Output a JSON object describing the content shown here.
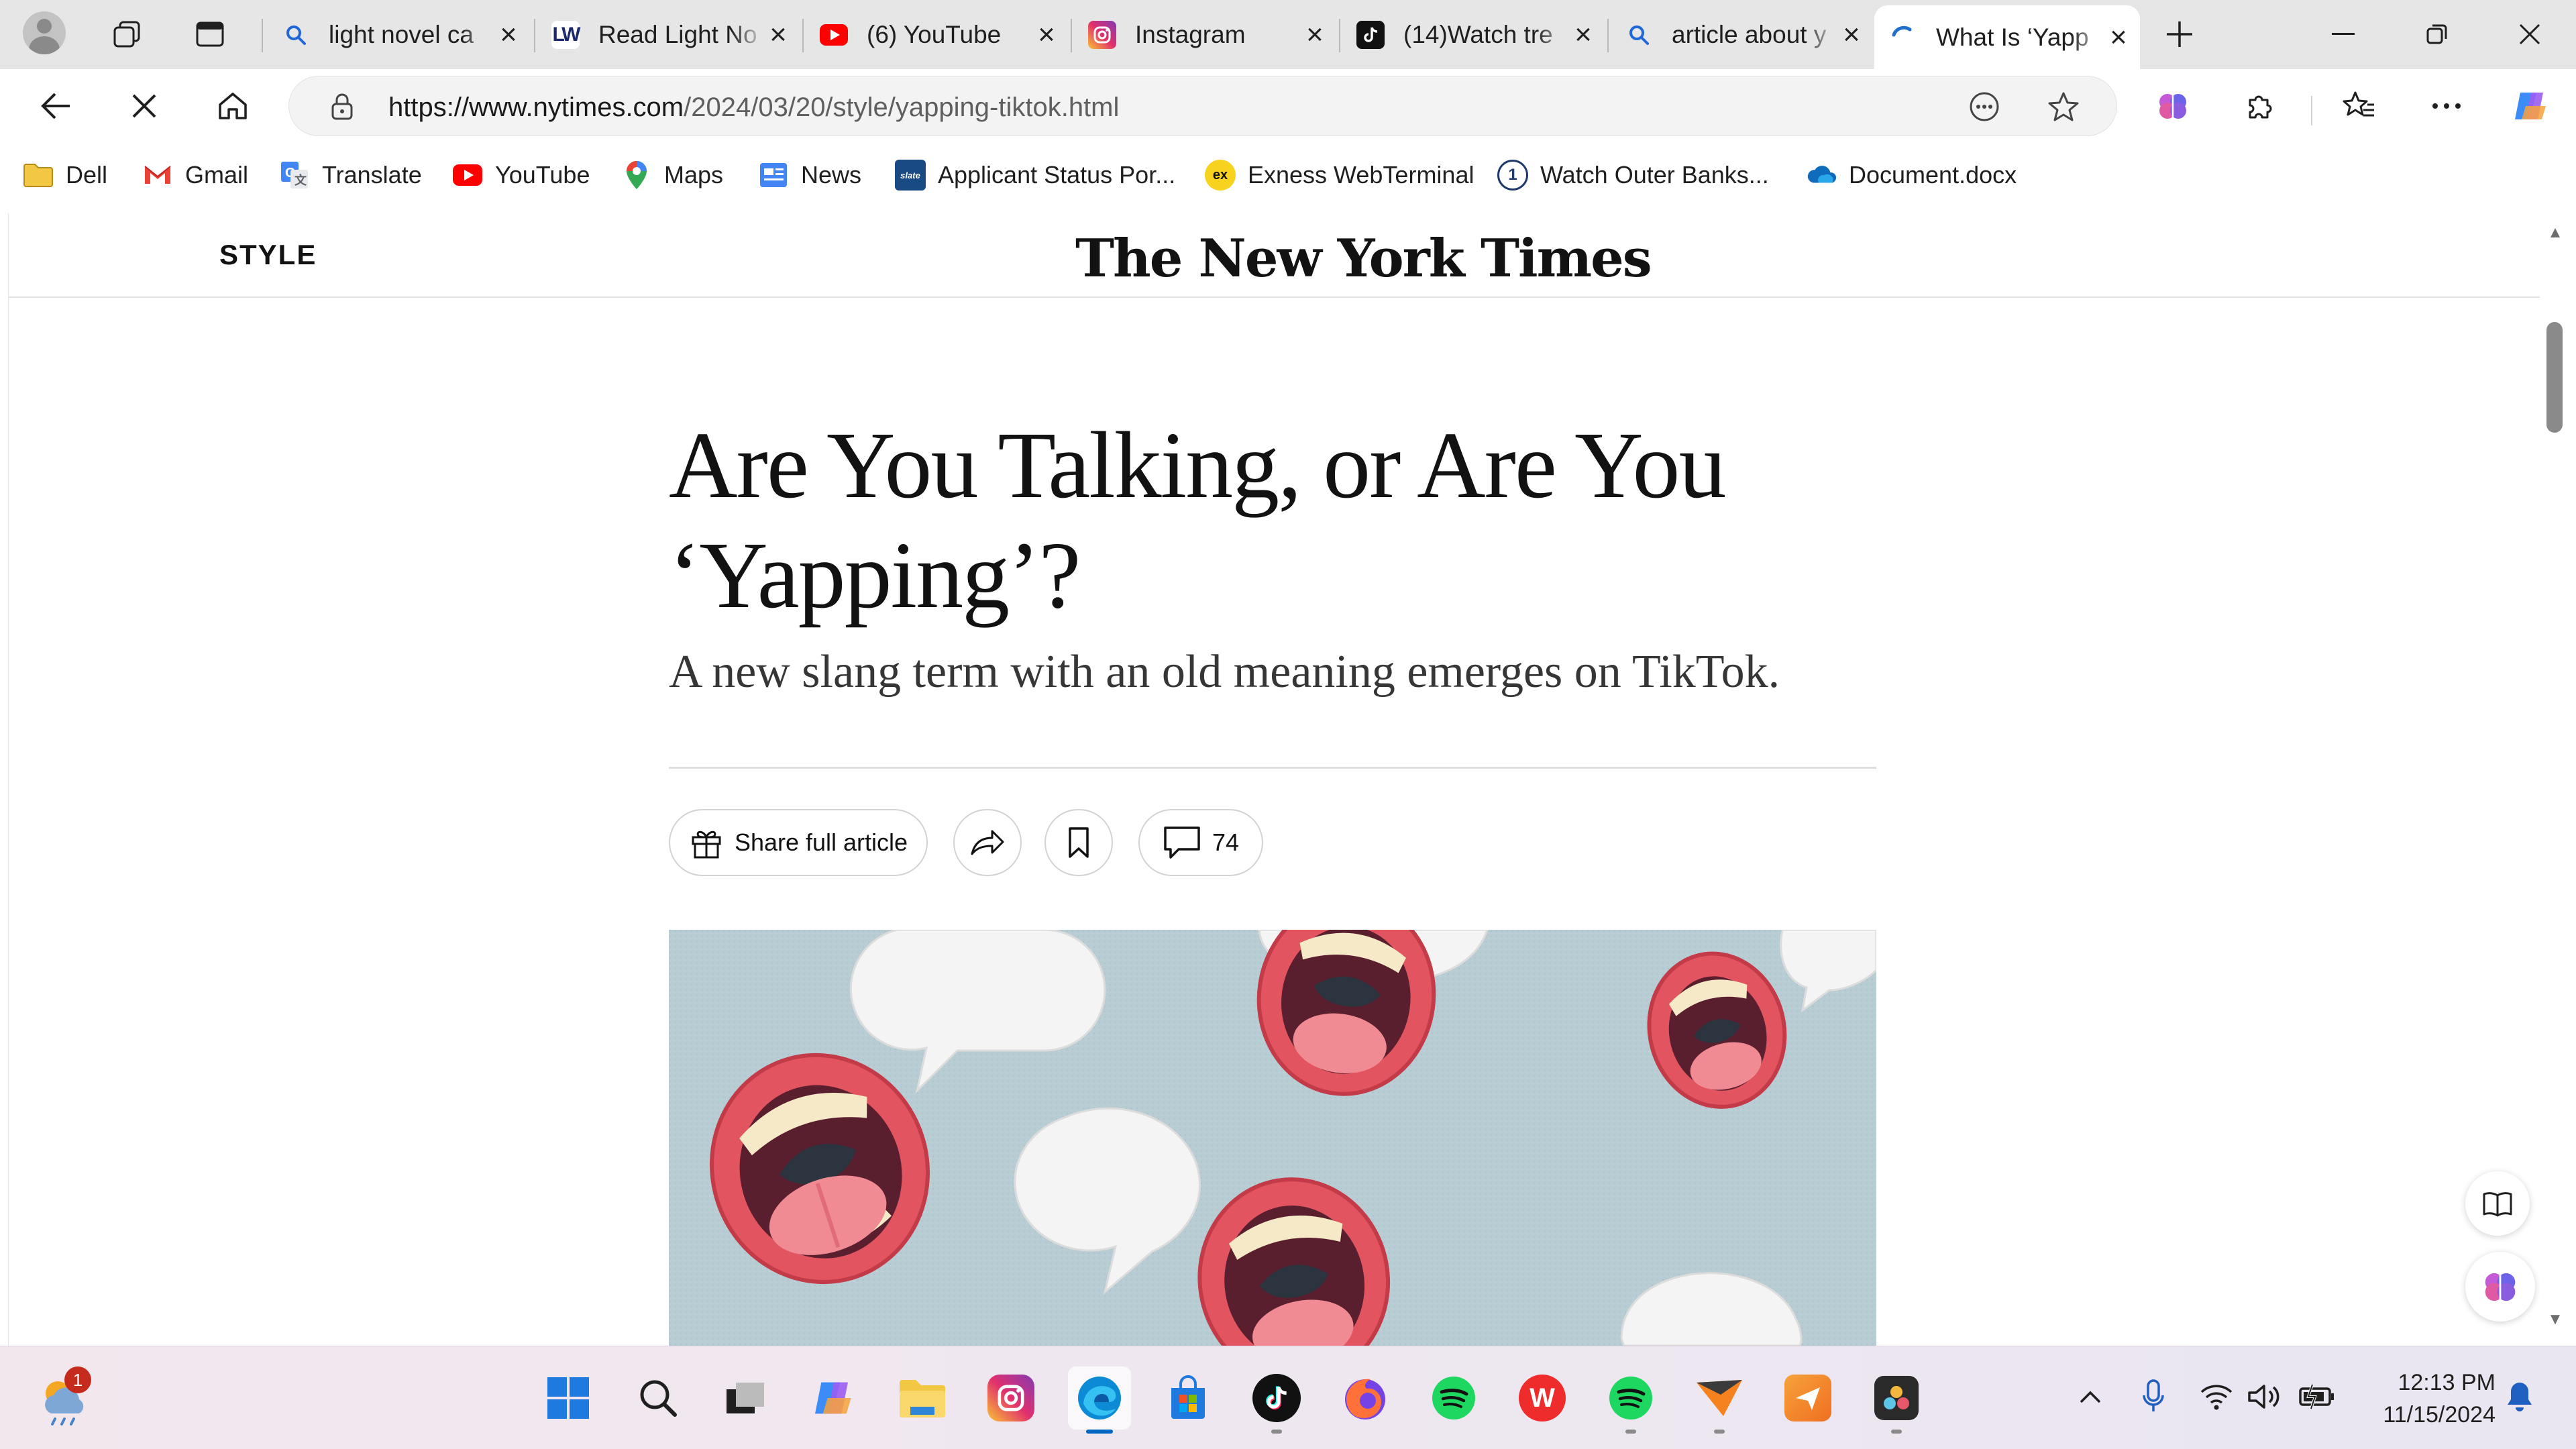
{
  "browser": {
    "tabs": [
      {
        "title": "light novel ca",
        "favicon": "bing-search-icon"
      },
      {
        "title": "Read Light No",
        "favicon": "lnw-icon"
      },
      {
        "title": "(6) YouTube",
        "favicon": "youtube-icon"
      },
      {
        "title": "Instagram",
        "favicon": "instagram-icon"
      },
      {
        "title": "(14)Watch tre",
        "favicon": "tiktok-icon"
      },
      {
        "title": "article about y",
        "favicon": "bing-search-icon"
      },
      {
        "title": "What Is ‘Yapp",
        "favicon": "loading-icon"
      }
    ],
    "url_domain": "https://www.nytimes.com",
    "url_path": "/2024/03/20/style/yapping-tiktok.html",
    "favorites": [
      {
        "label": "Dell",
        "icon": "folder-icon"
      },
      {
        "label": "Gmail",
        "icon": "gmail-icon"
      },
      {
        "label": "Translate",
        "icon": "translate-icon"
      },
      {
        "label": "YouTube",
        "icon": "youtube-icon"
      },
      {
        "label": "Maps",
        "icon": "maps-icon"
      },
      {
        "label": "News",
        "icon": "news-icon"
      },
      {
        "label": "Applicant Status Por...",
        "icon": "slate-icon"
      },
      {
        "label": "Exness WebTerminal",
        "icon": "exness-icon"
      },
      {
        "label": "Watch Outer Banks...",
        "icon": "one-icon"
      },
      {
        "label": "Document.docx",
        "icon": "onedrive-icon"
      }
    ]
  },
  "article": {
    "section": "STYLE",
    "masthead": "The New York Times",
    "headline": "Are You Talking, or Are You ‘Yapping’?",
    "summary": "A new slang term with an old meaning emerges on TikTok.",
    "share_label": "Share full article",
    "comment_count": "74"
  },
  "taskbar": {
    "time": "12:13 PM",
    "date": "11/15/2024",
    "weather_badge": "1"
  },
  "colors": {
    "nyt_black": "#121212",
    "hero_background": "#b8ccd3",
    "mouth_red": "#e2545f",
    "edge_accent": "#0067c0"
  }
}
